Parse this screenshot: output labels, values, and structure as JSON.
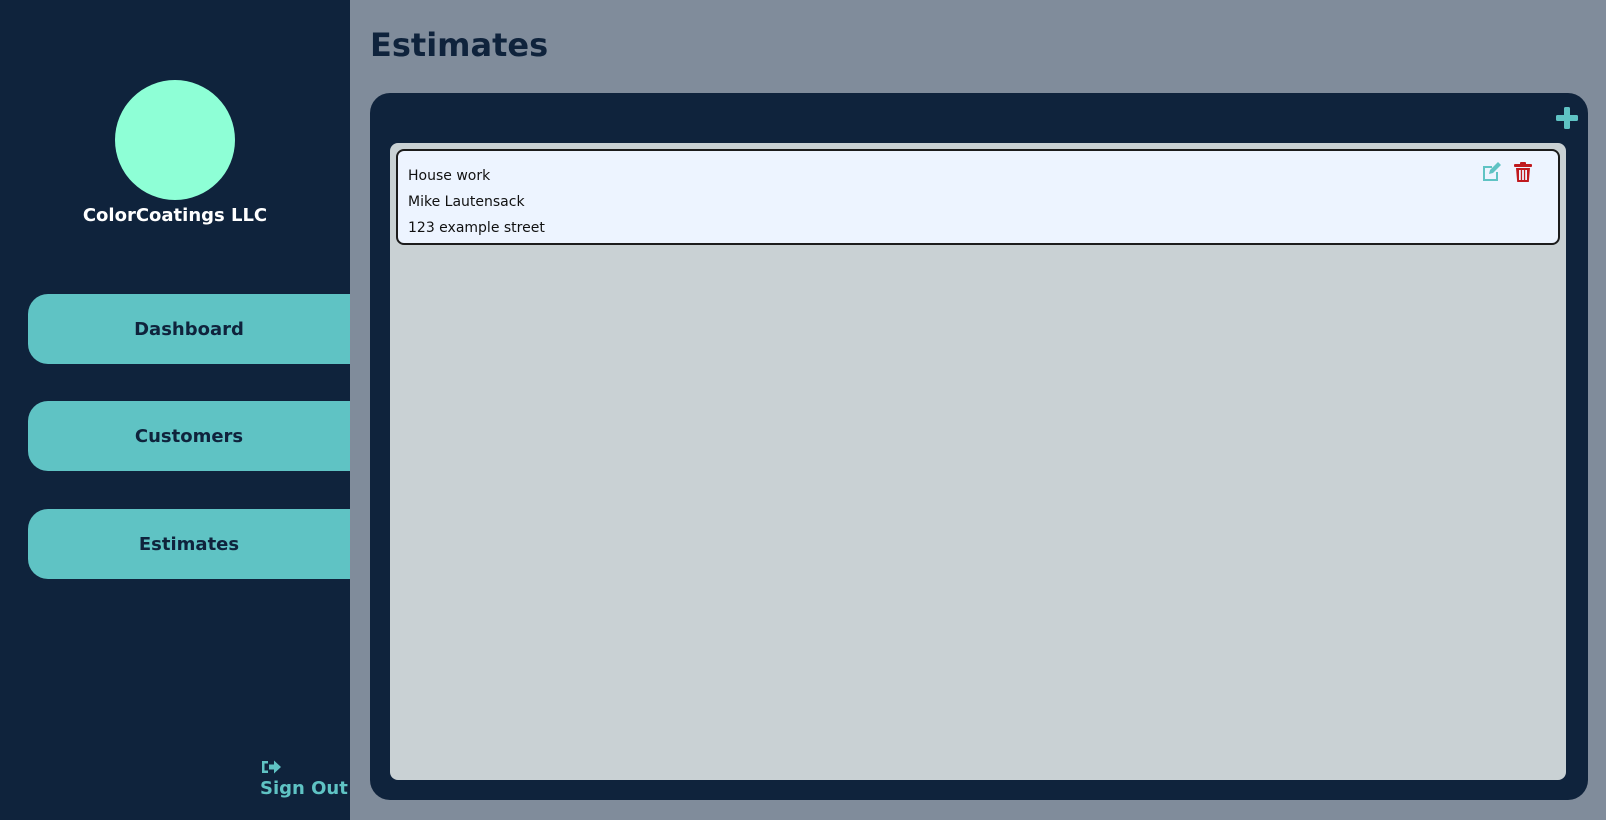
{
  "sidebar": {
    "company_name": "ColorCoatings LLC",
    "nav": {
      "dashboard": "Dashboard",
      "customers": "Customers",
      "estimates": "Estimates"
    },
    "sign_out": "Sign Out"
  },
  "main": {
    "title": "Estimates",
    "estimates": [
      {
        "job": "House work",
        "customer": "Mike Lautensack",
        "address": "123 example street"
      }
    ]
  },
  "colors": {
    "sidebar_bg": "#0f233c",
    "nav_bg": "#5fc3c4",
    "avatar": "#8effd6",
    "page_bg": "#808c9b",
    "delete": "#c0191e"
  },
  "icons": {
    "add": "plus-icon",
    "edit": "edit-icon",
    "delete": "trash-icon",
    "sign_out": "sign-out-icon"
  }
}
